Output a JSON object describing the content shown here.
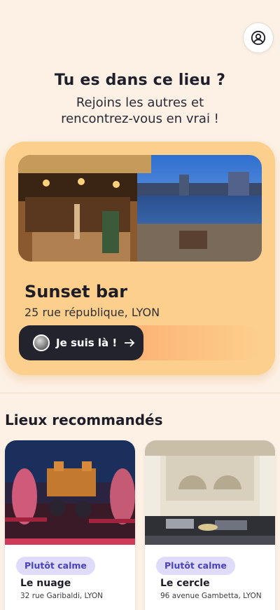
{
  "header": {
    "title": "Tu es dans ce lieu ?",
    "subtitle_line1": "Rejoins les autres et",
    "subtitle_line2": "rencontrez-vous en vrai !",
    "profile_icon": "user-circle-icon"
  },
  "current_venue": {
    "name": "Sunset bar",
    "address": "25 rue république, LYON",
    "checkin_label": "Je suis là !",
    "arrow_icon": "arrow-right-icon",
    "card_color": "#fdcf8c"
  },
  "recommended": {
    "title": "Lieux recommandés",
    "items": [
      {
        "tag": "Plutôt calme",
        "name": "Le nuage",
        "address": "32 rue Garibaldi, LYON"
      },
      {
        "tag": "Plutôt calme",
        "name": "Le cercle",
        "address": "96 avenue Gambetta, LYON"
      }
    ]
  },
  "colors": {
    "background": "#fdf1e6",
    "accent_orange": "#f8a65e",
    "dark_button": "#23232d",
    "tag_background": "#dedbfb",
    "tag_text": "#4b43b8"
  }
}
